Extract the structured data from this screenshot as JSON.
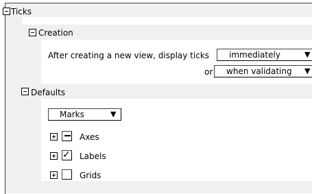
{
  "tree": {
    "ticks": {
      "label": "Ticks"
    },
    "creation": {
      "label": "Creation",
      "description": "After creating a new view, display ticks",
      "display_option": "immediately",
      "or_label": "or",
      "alt_option": "when validating"
    },
    "defaults": {
      "label": "Defaults",
      "category_select": "Marks",
      "items": [
        {
          "label": "Axes",
          "state": "indeterminate"
        },
        {
          "label": "Labels",
          "state": "checked"
        },
        {
          "label": "Grids",
          "state": "unchecked"
        }
      ]
    }
  },
  "icons": {
    "dropdown": "▼",
    "check": "✓"
  }
}
